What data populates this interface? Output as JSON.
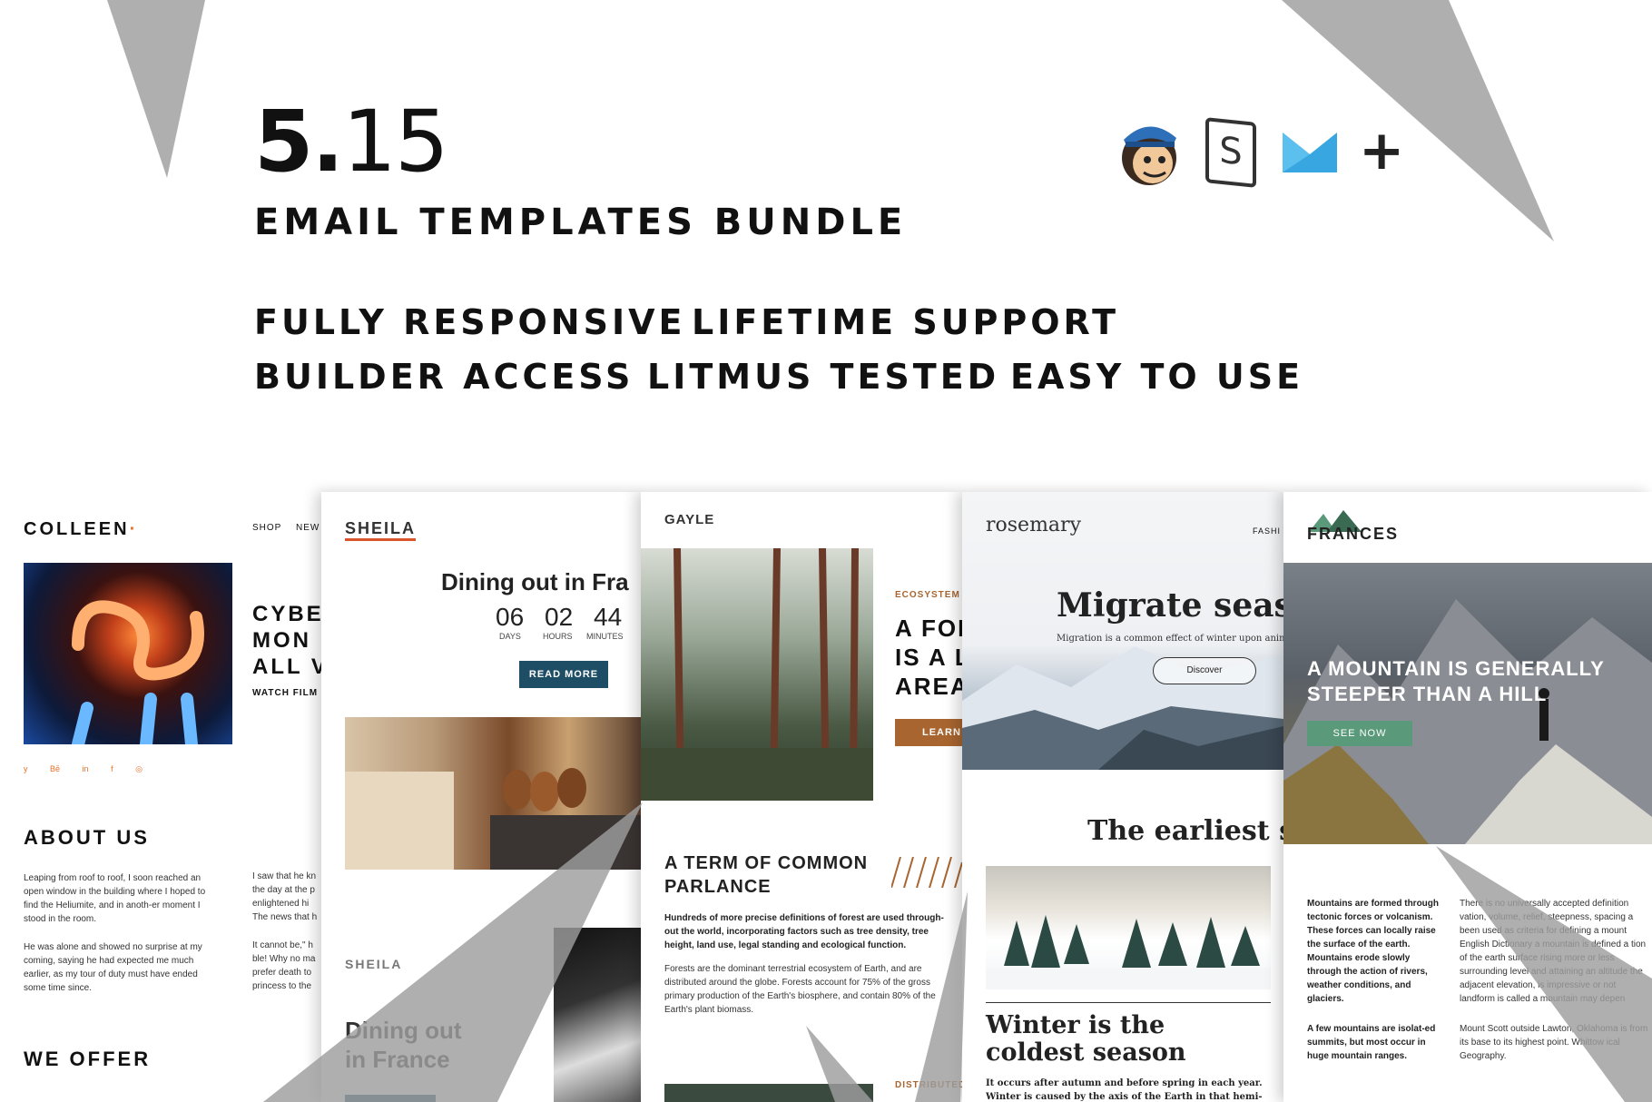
{
  "header": {
    "version_bold": "5.",
    "version_light": "15",
    "subtitle": "EMAIL TEMPLATES BUNDLE",
    "features": [
      "FULLY RESPONSIVE",
      "LIFETIME SUPPORT",
      "BUILDER ACCESS",
      "LITMUS TESTED",
      "EASY TO USE"
    ],
    "platforms": [
      "mailchimp-icon",
      "stampready-icon",
      "campaign-monitor-icon",
      "plus-icon"
    ],
    "stamp_letter": "S",
    "plus": "+"
  },
  "colleen": {
    "logo": "COLLEEN",
    "logo_dot": "·",
    "nav": [
      "SHOP",
      "NEW"
    ],
    "hero_lines": [
      "CYBE",
      "MON",
      "ALL V"
    ],
    "watch": "WATCH FILM",
    "social": [
      "y",
      "Bē",
      "in",
      "f",
      "◎"
    ],
    "about_title": "ABOUT US",
    "about_p1": "Leaping from roof to roof, I soon reached an open window in the building where I hoped to find the Heliumite, and in anoth-er moment I stood in the room.",
    "about_p2": "He was alone and showed no surprise at my coming, saying he had expected me much earlier, as my tour of duty must have ended some time since.",
    "col2_p1": "I saw that he kn the day at the p enlightened hi The news that h",
    "col2_p2": "It cannot be,\" h ble! Why no ma prefer death to princess to the",
    "offer_title": "WE OFFER",
    "accent": "#e8702a"
  },
  "sheila": {
    "logo": "SHEILA",
    "headline": "Dining out in Fra",
    "countdown": [
      {
        "value": "06",
        "label": "DAYS"
      },
      {
        "value": "02",
        "label": "HOURS"
      },
      {
        "value": "44",
        "label": "MINUTES"
      }
    ],
    "button": "READ MORE",
    "logo2": "SHEILA",
    "headline2_l1": "Dining out",
    "headline2_l2": "in France",
    "accent": "#1e4e66"
  },
  "gayle": {
    "logo": "GAYLE",
    "kicker": "ECOSYSTEM OF I",
    "hero_lines": [
      "A FOR",
      "IS A L",
      "AREA"
    ],
    "button": "LEARN MO",
    "term_l1": "A TERM OF COMMON",
    "term_l2": "PARLANCE",
    "para_bold": "Hundreds of more precise definitions of forest are used through-out the world, incorporating factors such as tree density, tree height, land use, legal standing and ecological function.",
    "para": "Forests are the dominant terrestrial ecosystem of Earth, and are distributed around the globe. Forests account for 75% of the gross primary production of the Earth's biosphere, and contain 80% of the Earth's plant biomass.",
    "kicker2": "DISTRIBUTED AR",
    "accent": "#a8652f"
  },
  "rosemary": {
    "logo": "rosemary",
    "nav": "FASHI",
    "headline": "Migrate season",
    "sub": "Migration is a common effect of winter upon anima",
    "button": "Discover",
    "earliest": "The earliest sun",
    "winter_l1": "Winter is the",
    "winter_l2": "coldest season",
    "body": "It occurs after autumn and before spring in each year. Winter is caused by the axis of the Earth in that hemi-"
  },
  "frances": {
    "logo": "FRANCES",
    "hero_l1": "A MOUNTAIN IS GENERALLY",
    "hero_l2": "STEEPER THAN A HILL",
    "button": "SEE NOW",
    "left_p1": "Mountains are formed through tectonic forces or volcanism. These forces can locally raise the surface of the earth. Mountains erode slowly through the action of rivers, weather conditions, and glaciers.",
    "left_p2": "A few mountains are isolat-ed summits, but most occur in huge mountain ranges.",
    "right_p1": "There is no universally accepted definition vation, volume, relief, steepness, spacing a been used as criteria for defining a mount English Dictionary a mountain is defined a tion of the earth surface rising more or less surrounding level and attaining an altitude the adjacent elevation, is impressive or not landform is called a mountain may depen",
    "right_p2": "Mount Scott outside Lawton, Oklahoma is from its base to its highest point. Whittow ical Geography.",
    "accent": "#5a9a7a"
  }
}
